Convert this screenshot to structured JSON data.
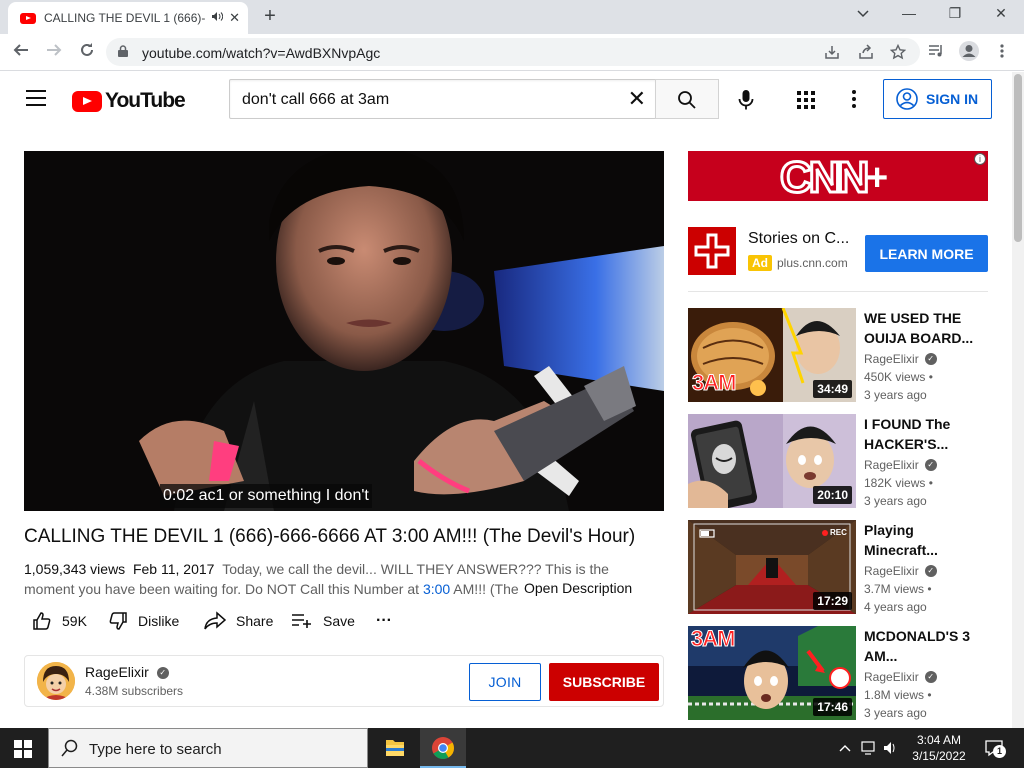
{
  "browser": {
    "tab_title": "CALLING THE DEVIL 1 (666)-",
    "url": "youtube.com/watch?v=AwdBXNvpAgc",
    "new_tab": "+",
    "tab_close": "✕",
    "minimize": "—",
    "restore": "❐",
    "close": "✕"
  },
  "header": {
    "logo_text": "YouTube",
    "search_value": "don't call 666 at 3am",
    "search_clear": "✕",
    "sign_in": "SIGN IN"
  },
  "video": {
    "caption": "0:02 ac1 or something I don't",
    "title": "CALLING THE DEVIL 1 (666)-666-6666 AT 3:00 AM!!! (The Devil's Hour)",
    "views": "1,059,343 views",
    "date": "Feb 11, 2017",
    "description_a": "Today, we call the devil... WILL THEY ANSWER??? This is the moment you have been waiting for. Do NOT Call this Number at ",
    "description_link": "3:00",
    "description_b": " AM!!! (The",
    "open_description": "Open Description"
  },
  "actions": {
    "likes": "59K",
    "dislike": "Dislike",
    "share": "Share",
    "save": "Save",
    "more": "···"
  },
  "channel": {
    "name": "RageElixir",
    "subscribers": "4.38M subscribers",
    "join": "JOIN",
    "subscribe": "SUBSCRIBE"
  },
  "ad": {
    "banner_text": "CNN",
    "banner_plus": "+",
    "info": "i",
    "title": "Stories on C...",
    "badge": "Ad",
    "domain": "plus.cnn.com",
    "cta": "LEARN MORE"
  },
  "recommendations": [
    {
      "title": "WE USED THE OUIJA BOARD...",
      "channel": "RageElixir",
      "views": "450K views •",
      "age": "3 years ago",
      "duration": "34:49",
      "thumb_text": "3AM"
    },
    {
      "title": "I FOUND The HACKER'S...",
      "channel": "RageElixir",
      "views": "182K views •",
      "age": "3 years ago",
      "duration": "20:10"
    },
    {
      "title": "Playing Minecraft...",
      "channel": "RageElixir",
      "views": "3.7M views •",
      "age": "4 years ago",
      "duration": "17:29",
      "thumb_text": "REC"
    },
    {
      "title": "MCDONALD'S 3 AM...",
      "channel": "RageElixir",
      "views": "1.8M views •",
      "age": "3 years ago",
      "duration": "17:46",
      "thumb_text": "3AM"
    }
  ],
  "taskbar": {
    "search_placeholder": "Type here to search",
    "time": "3:04 AM",
    "date": "3/15/2022",
    "notifications": "1"
  },
  "colors": {
    "youtube_red": "#ff0000",
    "subscribe_red": "#cc0000",
    "link_blue": "#065fd4",
    "cta_blue": "#1a73e8",
    "ad_yellow": "#f9c404"
  }
}
